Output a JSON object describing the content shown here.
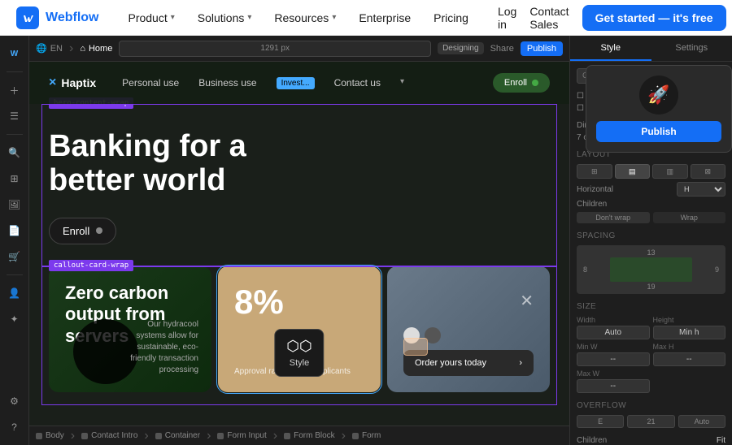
{
  "topNav": {
    "logo": "Webflow",
    "logoIcon": "W",
    "items": [
      {
        "label": "Product",
        "hasDropdown": true
      },
      {
        "label": "Solutions",
        "hasDropdown": true
      },
      {
        "label": "Resources",
        "hasDropdown": true
      },
      {
        "label": "Enterprise",
        "hasDropdown": false
      },
      {
        "label": "Pricing",
        "hasDropdown": false
      }
    ],
    "rightLinks": [
      {
        "label": "Log in"
      },
      {
        "label": "Contact Sales"
      }
    ],
    "ctaLabel": "Get started — it's free"
  },
  "editorTopBar": {
    "flagEmoji": "🌐",
    "langCode": "EN",
    "homeLabel": "Home",
    "urlText": "1291 px",
    "designingLabel": "Designing",
    "shareLabel": "Share",
    "publishLabel": "Publish"
  },
  "siteNav": {
    "logoText": "Haptix",
    "links": [
      "Personal use",
      "Business use",
      "Invest...",
      "Contact us"
    ],
    "enrollLabel": "Enroll"
  },
  "hero": {
    "outlineLabel": "hero-content-wrap",
    "titleLine1": "Banking for a",
    "titleLine2": "better world",
    "enrollBtn": "Enroll"
  },
  "callout": {
    "outlineLabel": "callout-card-wrap",
    "card1": {
      "title": "Zero carbon output from servers",
      "subtext": "Our hydracool systems allow for sustainable, eco-friendly transaction processing"
    },
    "card2": {
      "percent": "8%",
      "label": "Approval rate for new applicants"
    },
    "card3": {
      "orderBtn": "Order yours today"
    }
  },
  "styleTooltip": {
    "icon": "⬡⬡",
    "label": "Style"
  },
  "bottomBar": {
    "items": [
      "Body",
      "Contact Intro",
      "Container",
      "Form Input",
      "Form Block",
      "Form"
    ]
  },
  "rightPanel": {
    "tabs": [
      "Style",
      "Settings"
    ],
    "publishPopup": {
      "label": "Publish"
    },
    "classNamePlaceholder": "Class Name",
    "layout": {
      "title": "Layout",
      "horizontalLabel": "Horizontal",
      "childrenLabel": "Children",
      "dontWrapLabel": "Don't wrap",
      "wrapLabel": "Wrap"
    },
    "spacing": {
      "title": "Spacing",
      "top": "13",
      "right": "9",
      "bottom": "19",
      "left": "8"
    },
    "size": {
      "title": "Size",
      "widthLabel": "Width",
      "widthVal": "Auto",
      "heightLabel": "Height",
      "heightVal": "Min h",
      "minWLabel": "Min W",
      "minWVal": "--",
      "maxWLabel": "Max W",
      "maxWVal": "--",
      "maxHLabel": "Max H",
      "maxHVal": "--"
    },
    "overflow": {
      "title": "Overflow",
      "val1": "E",
      "val2": "21",
      "val3": "Auto"
    },
    "children": {
      "title": "Children",
      "val": "Fit"
    }
  }
}
